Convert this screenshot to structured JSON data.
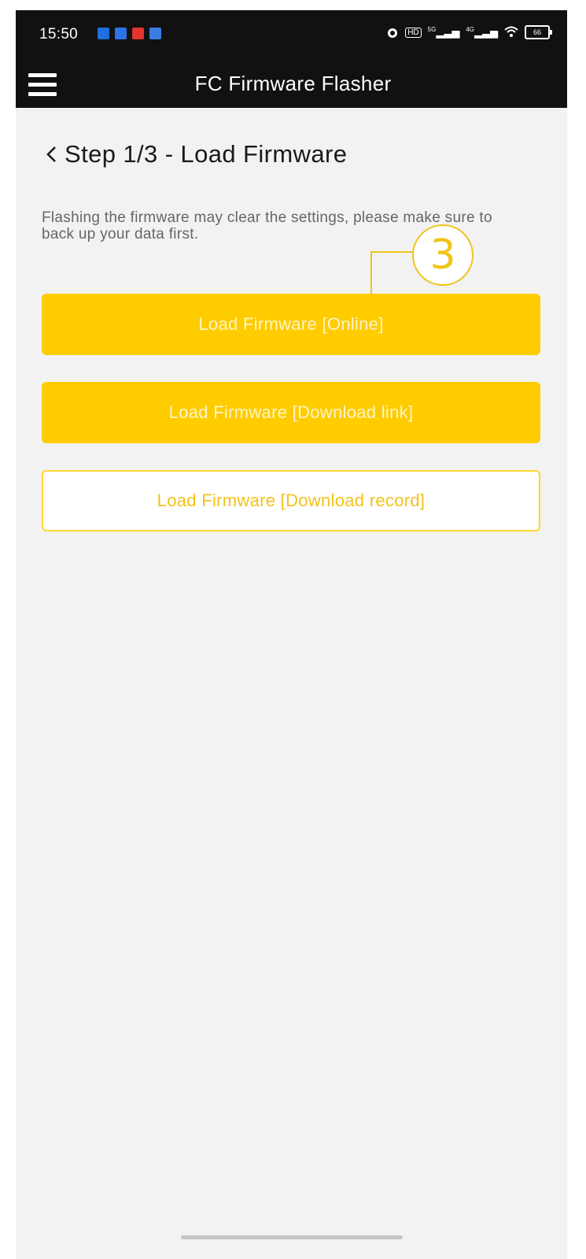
{
  "status_bar": {
    "time": "15:50",
    "notification_icons": [
      {
        "name": "app-notification-icon-1",
        "color": "#1e6fe0"
      },
      {
        "name": "app-notification-icon-2",
        "color": "#2c73e8"
      },
      {
        "name": "app-notification-icon-3",
        "color": "#e3342f"
      },
      {
        "name": "app-notification-icon-4",
        "color": "#3b7de5"
      }
    ],
    "network_1": "5G",
    "network_2": "4G",
    "hd_label": "HD",
    "battery": "66"
  },
  "app_bar": {
    "title": "FC Firmware Flasher",
    "menu_icon": "hamburger-menu-icon"
  },
  "step": {
    "title": "Step 1/3 - Load Firmware",
    "notice": "Flashing the firmware may clear the settings, please make sure to back up your data first."
  },
  "buttons": {
    "online": "Load Firmware [Online]",
    "download_link": "Load Firmware [Download link]",
    "download_record": "Load Firmware [Download record]"
  },
  "annotation": {
    "number": "3"
  },
  "colors": {
    "accent": "#ffcc00",
    "bar_background": "#111111",
    "page_background": "#f2f2f2"
  }
}
